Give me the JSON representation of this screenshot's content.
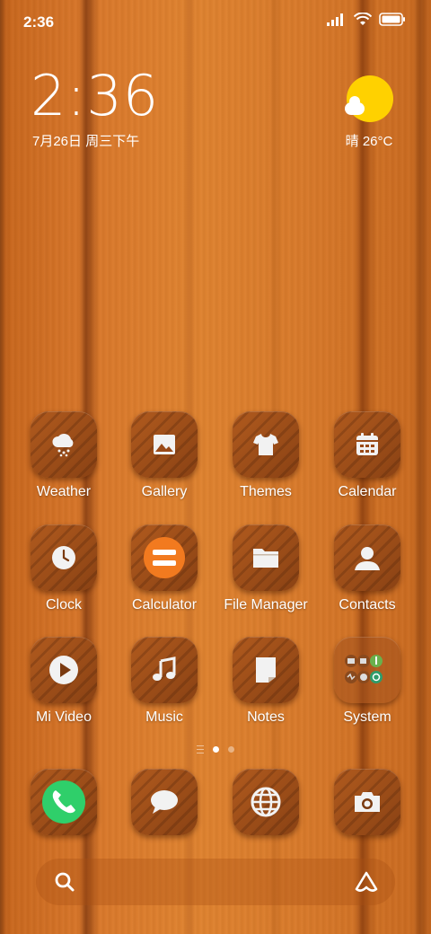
{
  "status_bar": {
    "time": "2:36"
  },
  "lock_clock": {
    "time": "2:36",
    "date": "7月26日 周三下午"
  },
  "weather_widget": {
    "text": "晴 26°C",
    "icon": "sunny-cloud-icon",
    "sun_color": "#ffd100"
  },
  "apps": [
    {
      "label": "Weather",
      "icon": "weather-icon"
    },
    {
      "label": "Gallery",
      "icon": "gallery-icon"
    },
    {
      "label": "Themes",
      "icon": "themes-icon"
    },
    {
      "label": "Calendar",
      "icon": "calendar-icon"
    },
    {
      "label": "Clock",
      "icon": "clock-icon"
    },
    {
      "label": "Calculator",
      "icon": "calculator-icon"
    },
    {
      "label": "File Manager",
      "icon": "folder-icon"
    },
    {
      "label": "Contacts",
      "icon": "contacts-icon"
    },
    {
      "label": "Mi Video",
      "icon": "play-icon"
    },
    {
      "label": "Music",
      "icon": "music-icon"
    },
    {
      "label": "Notes",
      "icon": "notes-icon"
    },
    {
      "label": "System",
      "icon": "folder-system-icon"
    }
  ],
  "page_indicator": {
    "pages": 2,
    "active": 1
  },
  "dock": [
    {
      "icon": "phone-icon"
    },
    {
      "icon": "messages-icon"
    },
    {
      "icon": "browser-icon"
    },
    {
      "icon": "camera-icon"
    }
  ],
  "colors": {
    "wood": "#d9772a",
    "phone_green": "#2fcf6a",
    "calculator_orange": "#f27a1f"
  }
}
